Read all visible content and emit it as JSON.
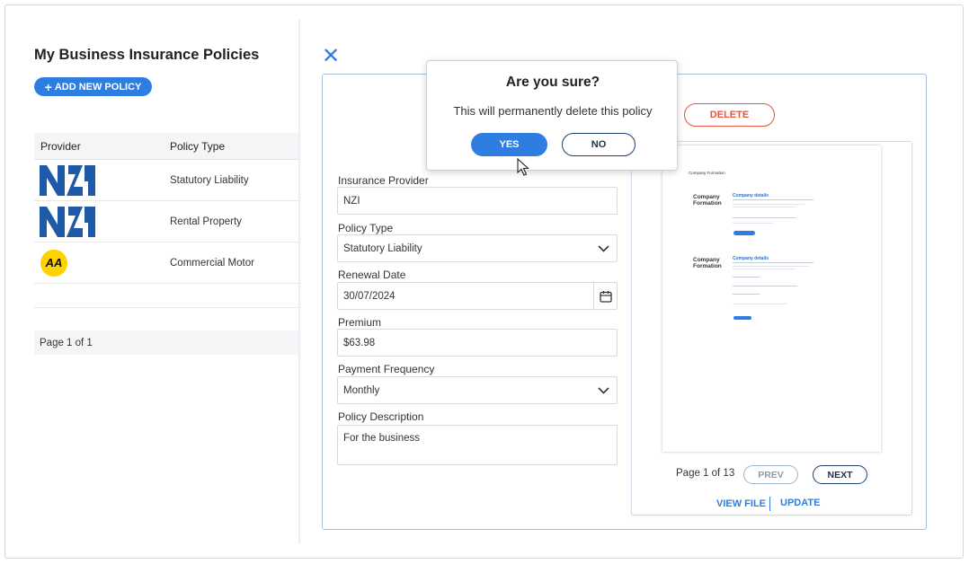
{
  "list": {
    "title": "My Business Insurance Policies",
    "add_button": "ADD NEW POLICY",
    "columns": [
      "Provider",
      "Policy Type"
    ],
    "rows": [
      {
        "provider": "NZI",
        "policy_type": "Statutory Liability"
      },
      {
        "provider": "NZI",
        "policy_type": "Rental Property"
      },
      {
        "provider": "AA",
        "policy_type": "Commercial Motor"
      }
    ],
    "pager": "Page 1 of 1"
  },
  "detail": {
    "close_icon": "close-x-icon",
    "fields": {
      "provider_label": "Insurance Provider",
      "provider_value": "NZI",
      "policy_type_label": "Policy Type",
      "policy_type_value": "Statutory Liability",
      "renewal_label": "Renewal Date",
      "renewal_value": "30/07/2024",
      "premium_label": "Premium",
      "premium_value": "$63.98",
      "frequency_label": "Payment Frequency",
      "frequency_value": "Monthly",
      "description_label": "Policy Description",
      "description_value": "For the business"
    },
    "delete_button": "DELETE",
    "preview": {
      "pager": "Page 1 of 13",
      "prev": "PREV",
      "next": "NEXT",
      "view_file": "VIEW FILE",
      "update": "UPDATE",
      "doc_header": "Company Formation",
      "section_left": "Company Formation",
      "section_title": "Company details"
    }
  },
  "dialog": {
    "title": "Are you sure?",
    "message": "This will permanently delete this policy",
    "yes": "YES",
    "no": "NO"
  },
  "colors": {
    "accent": "#2e7de0",
    "danger": "#e0553c",
    "nzi_blue": "#1f5aa8",
    "aa_yellow": "#ffd200"
  }
}
